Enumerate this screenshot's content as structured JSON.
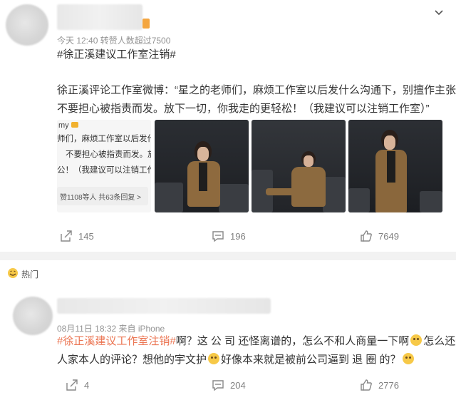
{
  "post": {
    "meta": "今天 12:40 转赞人数超过7500",
    "topic": "#徐正溪建议工作室注销#",
    "text_line1": "徐正溪评论工作室微博：“星之的老师们，麻烦工作室以后发什么沟通下，别擅作主张，",
    "text_line2": "不要担心被指责而发。放下一切，你我走的更轻松！（我建议可以注销工作室）”",
    "thumb": {
      "name": "my",
      "lines": [
        "师们，麻烦工作室以后发什",
        "不要担心被指责而发。放",
        "公！（我建议可以注销工作"
      ],
      "footer": "赞1108等人  共63条回复 >"
    },
    "actions": {
      "share": "145",
      "comment": "196",
      "like": "7649"
    }
  },
  "section": {
    "label": "热门"
  },
  "comment": {
    "meta": "08月11日 18:32 来自 iPhone",
    "topic": "#徐正溪建议工作室注销#",
    "text_a": "啊？这 公 司 还怪离谱的，怎么不和人商量一下啊",
    "text_b": "怎么还删",
    "text_c": "人家本人的评论？想他的宇文护",
    "text_d": "好像本来就是被前公司逼到 退 圈 的？",
    "actions": {
      "share": "4",
      "comment": "204",
      "like": "2776"
    }
  },
  "icons": {
    "more": "chevron-down-icon",
    "share": "share-icon",
    "comment": "comment-icon",
    "like": "thumbs-up-icon",
    "hot": "hot-emoji-icon"
  },
  "colors": {
    "topic": "#eb7350",
    "meta": "#939393",
    "divider": "#f2f2f2"
  }
}
